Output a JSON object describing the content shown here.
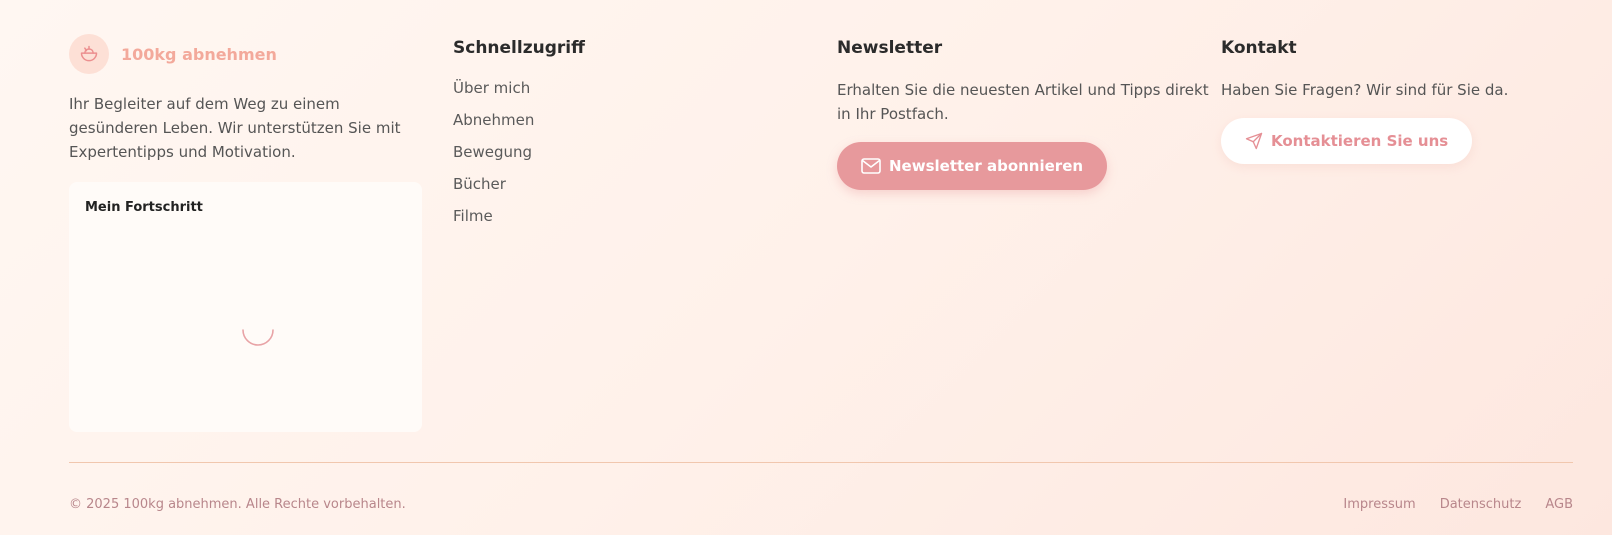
{
  "brand": {
    "name": "100kg abnehmen",
    "icon": "salad-bowl-icon",
    "description": "Ihr Begleiter auf dem Weg zu einem gesünderen Leben. Wir unterstützen Sie mit Expertentipps und Motivation."
  },
  "progress": {
    "title": "Mein Fortschritt"
  },
  "quicklinks": {
    "title": "Schnellzugriff",
    "items": [
      "Über mich",
      "Abnehmen",
      "Bewegung",
      "Bücher",
      "Filme"
    ]
  },
  "newsletter": {
    "title": "Newsletter",
    "text": "Erhalten Sie die neuesten Artikel und Tipps direkt in Ihr Postfach.",
    "button_label": "Newsletter abonnieren",
    "button_icon": "mail-icon"
  },
  "contact": {
    "title": "Kontakt",
    "text": "Haben Sie Fragen? Wir sind für Sie da.",
    "button_label": "Kontaktieren Sie uns",
    "button_icon": "send-icon"
  },
  "bottom": {
    "copyright": "© 2025 100kg abnehmen. Alle Rechte vorbehalten.",
    "links": [
      "Impressum",
      "Datenschutz",
      "AGB"
    ]
  },
  "colors": {
    "accent": "#e7999c",
    "brand_text": "#f3a99b",
    "divider": "#f1c7ae"
  }
}
